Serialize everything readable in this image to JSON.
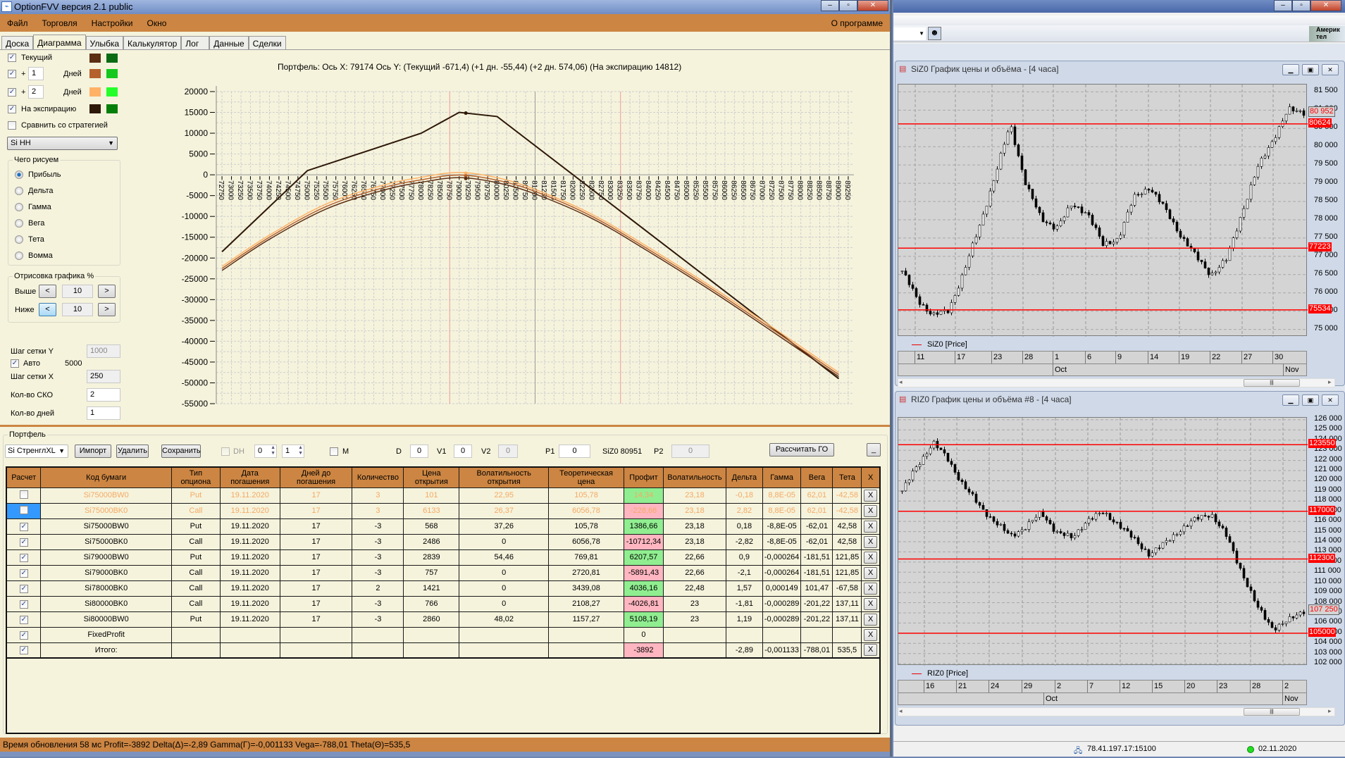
{
  "window": {
    "title": "OptionFVV версия 2.1 public",
    "app_icon": "chart-icon"
  },
  "menu": {
    "items": [
      "Файл",
      "Торговля",
      "Настройки",
      "Окно"
    ],
    "about": "О программе"
  },
  "tabs": [
    {
      "label": "Доска",
      "active": false
    },
    {
      "label": "Диаграмма",
      "active": true
    },
    {
      "label": "Улыбка",
      "active": false
    },
    {
      "label": "Калькулятор",
      "active": false
    },
    {
      "label": "Лог",
      "active": false
    },
    {
      "label": "Данные",
      "active": false
    },
    {
      "label": "Сделки",
      "active": false
    }
  ],
  "left_panel": {
    "current": {
      "label": "Текущий",
      "checked": true,
      "colors": [
        "#5c2e14",
        "#0b6b12"
      ]
    },
    "plus1": {
      "plus": "+",
      "days": "1",
      "unit": "Дней",
      "checked": true,
      "colors": [
        "#b5612d",
        "#14c81e"
      ]
    },
    "plus2": {
      "plus": "+",
      "days": "2",
      "unit": "Дней",
      "checked": true,
      "colors": [
        "#ffb266",
        "#24ff2a"
      ]
    },
    "expiration": {
      "label": "На экспирацию",
      "checked": true,
      "colors": [
        "#2e1808",
        "#067f0a"
      ]
    },
    "compare": {
      "label": "Сравнить со стратегией",
      "checked": false
    },
    "instrument": "Si HH",
    "draw_group": {
      "title": "Чего рисуем",
      "options": [
        "Прибыль",
        "Дельта",
        "Гамма",
        "Вега",
        "Тета",
        "Вомма"
      ],
      "selected": "Прибыль"
    },
    "range_group": {
      "title": "Отрисовка графика %",
      "above_label": "Выше",
      "above": "10",
      "below_label": "Ниже",
      "below": "10",
      "dec": "<",
      "inc": ">"
    },
    "grid_y_label": "Шаг сетки Y",
    "grid_y": "1000",
    "auto_label": "Авто",
    "auto_checked": true,
    "auto_value": "5000",
    "grid_x_label": "Шаг сетки X",
    "grid_x": "250",
    "sko_label": "Кол-во СКО",
    "sko": "2",
    "days_label": "Кол-во дней",
    "days": "1"
  },
  "chart_data": {
    "type": "line",
    "title": "Портфель: Ось X: 79174 Ось Y:  (Текущий -671,4)  (+1 дн. -55,44)  (+2 дн. 574,06)  (На экспирацию 14812)",
    "xlim": [
      72600,
      89400
    ],
    "ylim": [
      -55000,
      20000
    ],
    "y_ticks": [
      20000,
      15000,
      10000,
      5000,
      0,
      -5000,
      -10000,
      -15000,
      -20000,
      -25000,
      -30000,
      -35000,
      -40000,
      -45000,
      -50000,
      -55000
    ],
    "x_tick_start": 72750,
    "x_tick_end": 89250,
    "x_tick_step": 250,
    "grid": true,
    "cursor_x": 79174,
    "vlines": [
      {
        "x": 78750,
        "color": "#f4a0a0"
      },
      {
        "x": 81000,
        "color": "#9a9a9a"
      },
      {
        "x": 83250,
        "color": "#f4a0a0"
      }
    ],
    "series": [
      {
        "name": "На экспирацию",
        "color": "#2e1808",
        "x": [
          72750,
          75000,
          78000,
          79000,
          80000,
          89000
        ],
        "y": [
          -18500,
          1000,
          10000,
          15000,
          14000,
          -49000
        ]
      },
      {
        "name": "+2 дн.",
        "color": "#ffb266",
        "x": [
          72750,
          74000,
          75500,
          77000,
          78000,
          79000,
          80000,
          81000,
          82500,
          84000,
          86000,
          89000
        ],
        "y": [
          -22000,
          -14500,
          -7000,
          -2500,
          -600,
          574,
          -700,
          -3500,
          -9500,
          -17500,
          -29000,
          -47500
        ]
      },
      {
        "name": "+1 дн.",
        "color": "#b5612d",
        "x": [
          72750,
          74000,
          75500,
          77000,
          78000,
          79000,
          80000,
          81000,
          82500,
          84000,
          86000,
          89000
        ],
        "y": [
          -22500,
          -15000,
          -7600,
          -3100,
          -1200,
          -55,
          -1300,
          -4000,
          -10000,
          -18000,
          -29500,
          -48000
        ]
      },
      {
        "name": "Текущий",
        "color": "#5c2e14",
        "x": [
          72750,
          74000,
          75500,
          77000,
          78000,
          79000,
          80000,
          81000,
          82500,
          84000,
          86000,
          89000
        ],
        "y": [
          -23000,
          -15500,
          -8200,
          -3700,
          -1800,
          -671,
          -1900,
          -4600,
          -10500,
          -18500,
          -30000,
          -48500
        ]
      }
    ]
  },
  "portfolio": {
    "title": "Портфель",
    "strategy": "Si СтренглXL",
    "import": "Импорт",
    "delete": "Удалить",
    "save": "Сохранить",
    "dh_label": "DH",
    "dh_checked": false,
    "spin1": "0",
    "spin2": "1",
    "m_label": "M",
    "m_checked": false,
    "d_label": "D",
    "d": "0",
    "v1_label": "V1",
    "v1": "0",
    "v2_label": "V2",
    "v2": "0",
    "p1_label": "P1",
    "p1": "0",
    "price_label": "SiZ0 80951",
    "p2_label": "P2",
    "p2": "0",
    "calc_go": "Рассчитать ГО",
    "minimize": "_",
    "columns": [
      "Расчет",
      "Код бумаги",
      "Тип опциона",
      "Дата погашения",
      "Дней до погашения",
      "Количество",
      "Цена открытия",
      "Волатильность открытия",
      "Теоретическая цена",
      "Профит",
      "Волатильность",
      "Дельта",
      "Гамма",
      "Вега",
      "Тета",
      "X"
    ],
    "rows": [
      {
        "on": false,
        "sel": true,
        "cells": [
          "Si75000BW0",
          "Put",
          "19.11.2020",
          "17",
          "3",
          "101",
          "22,95",
          "105,78",
          "14,34",
          "23,18",
          "-0,18",
          "8,8E-05",
          "62,01",
          "-42,58"
        ],
        "profit_sign": "pos"
      },
      {
        "on": false,
        "sel": true,
        "cells": [
          "Si75000BK0",
          "Call",
          "19.11.2020",
          "17",
          "3",
          "6133",
          "26,37",
          "6056,78",
          "-228,66",
          "23,18",
          "2,82",
          "8,8E-05",
          "62,01",
          "-42,58"
        ],
        "profit_sign": "neg",
        "selected": true
      },
      {
        "on": true,
        "cells": [
          "Si75000BW0",
          "Put",
          "19.11.2020",
          "17",
          "-3",
          "568",
          "37,26",
          "105,78",
          "1386,66",
          "23,18",
          "0,18",
          "-8,8E-05",
          "-62,01",
          "42,58"
        ],
        "profit_sign": "pos"
      },
      {
        "on": true,
        "cells": [
          "Si75000BK0",
          "Call",
          "19.11.2020",
          "17",
          "-3",
          "2486",
          "0",
          "6056,78",
          "-10712,34",
          "23,18",
          "-2,82",
          "-8,8E-05",
          "-62,01",
          "42,58"
        ],
        "profit_sign": "neg"
      },
      {
        "on": true,
        "cells": [
          "Si79000BW0",
          "Put",
          "19.11.2020",
          "17",
          "-3",
          "2839",
          "54,46",
          "769,81",
          "6207,57",
          "22,66",
          "0,9",
          "-0,000264",
          "-181,51",
          "121,85"
        ],
        "profit_sign": "pos"
      },
      {
        "on": true,
        "cells": [
          "Si79000BK0",
          "Call",
          "19.11.2020",
          "17",
          "-3",
          "757",
          "0",
          "2720,81",
          "-5891,43",
          "22,66",
          "-2,1",
          "-0,000264",
          "-181,51",
          "121,85"
        ],
        "profit_sign": "neg"
      },
      {
        "on": true,
        "cells": [
          "Si78000BK0",
          "Call",
          "19.11.2020",
          "17",
          "2",
          "1421",
          "0",
          "3439,08",
          "4036,16",
          "22,48",
          "1,57",
          "0,000149",
          "101,47",
          "-67,58"
        ],
        "profit_sign": "pos"
      },
      {
        "on": true,
        "cells": [
          "Si80000BK0",
          "Call",
          "19.11.2020",
          "17",
          "-3",
          "766",
          "0",
          "2108,27",
          "-4026,81",
          "23",
          "-1,81",
          "-0,000289",
          "-201,22",
          "137,11"
        ],
        "profit_sign": "neg"
      },
      {
        "on": true,
        "cells": [
          "Si80000BW0",
          "Put",
          "19.11.2020",
          "17",
          "-3",
          "2860",
          "48,02",
          "1157,27",
          "5108,19",
          "23",
          "1,19",
          "-0,000289",
          "-201,22",
          "137,11"
        ],
        "profit_sign": "pos"
      },
      {
        "on": true,
        "cells": [
          "FixedProfit",
          "",
          "",
          "",
          "",
          "",
          "",
          "",
          "0",
          "",
          "",
          "",
          "",
          ""
        ],
        "profit_sign": ""
      },
      {
        "on": true,
        "cells": [
          "Итого:",
          "",
          "",
          "",
          "",
          "",
          "",
          "",
          "-3892",
          "",
          "-2,89",
          "-0,001133",
          "-788,01",
          "535,5"
        ],
        "profit_sign": "neg"
      }
    ],
    "delete_row": "X"
  },
  "status": "Время обновления 58 мс  Profit=-3892 Delta(Δ)=-2,89 Gamma(Γ)=-0,001133 Vega=-788,01 Theta(Θ)=535,5",
  "right_app": {
    "banner": "Америк тел",
    "chart1": {
      "title": "SiZ0 График цены и объёма - [4 часа]",
      "legend": "SiZ0 [Price]",
      "y_ticks": [
        "81 500",
        "81 000",
        "80 500",
        "80 000",
        "79 500",
        "79 000",
        "78 500",
        "78 000",
        "77 500",
        "77 000",
        "76 500",
        "76 000",
        "75 500",
        "75 000"
      ],
      "y_range": [
        74800,
        81700
      ],
      "levels": [
        "80624",
        "77223",
        "75534"
      ],
      "price": "80 952",
      "days": [
        "11",
        "17",
        "23",
        "28",
        "1",
        "6",
        "9",
        "14",
        "19",
        "22",
        "27",
        "30"
      ],
      "months": [
        "Oct",
        "Nov"
      ],
      "path": [
        76600,
        75800,
        75400,
        75500,
        76600,
        77800,
        79200,
        80600,
        79000,
        78000,
        77800,
        78400,
        78200,
        77300,
        77500,
        78600,
        78900,
        78300,
        77600,
        77000,
        76500,
        76900,
        78200,
        79400,
        80200,
        81000,
        80950
      ]
    },
    "chart2": {
      "title": "RIZ0 График цены и объёма #8 - [4 часа]",
      "legend": "RIZ0 [Price]",
      "y_ticks": [
        "126 000",
        "125 000",
        "124 000",
        "123 000",
        "122 000",
        "121 000",
        "120 000",
        "119 000",
        "118 000",
        "117 000",
        "116 000",
        "115 000",
        "114 000",
        "113 000",
        "112 000",
        "111 000",
        "110 000",
        "109 000",
        "108 000",
        "107 000",
        "106 000",
        "105 000",
        "104 000",
        "103 000",
        "102 000"
      ],
      "y_range": [
        101800,
        126200
      ],
      "levels": [
        "123550",
        "117000",
        "112300",
        "105000"
      ],
      "price": "107 250",
      "days": [
        "16",
        "21",
        "24",
        "29",
        "2",
        "7",
        "12",
        "15",
        "20",
        "23",
        "28",
        "2"
      ],
      "months": [
        "Oct",
        "Nov"
      ],
      "path": [
        119000,
        121500,
        123800,
        122000,
        119500,
        117500,
        116000,
        114500,
        115500,
        116800,
        115000,
        114300,
        116200,
        116800,
        115800,
        114200,
        112800,
        113800,
        115200,
        116200,
        116800,
        114500,
        111000,
        107500,
        105500,
        106200,
        107250
      ]
    },
    "server": "78.41.197.17:15100",
    "date": "02.11.2020"
  }
}
